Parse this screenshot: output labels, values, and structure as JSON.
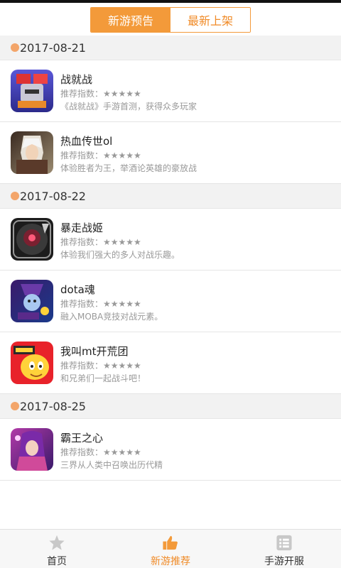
{
  "tabs": [
    {
      "label": "新游预告",
      "active": true
    },
    {
      "label": "最新上架",
      "active": false
    }
  ],
  "rating_label": "推荐指数：★★★★★",
  "sections": [
    {
      "date": "2017-08-21",
      "games": [
        {
          "name": "战就战",
          "rating": "推荐指数：★★★★★",
          "desc": "《战就战》手游首测，获得众多玩家",
          "icon": "knight-game-icon"
        },
        {
          "name": "热血传世ol",
          "rating": "推荐指数：★★★★★",
          "desc": "体验胜者为王，举酒论英雄的豪放战",
          "icon": "warrior-game-icon"
        }
      ]
    },
    {
      "date": "2017-08-22",
      "games": [
        {
          "name": "暴走战姬",
          "rating": "推荐指数：★★★★★",
          "desc": "体验我们强大的多人对战乐趣。",
          "icon": "dark-mech-game-icon"
        },
        {
          "name": "dota魂",
          "rating": "推荐指数：★★★★★",
          "desc": "融入MOBA竞技对战元素。",
          "icon": "mage-game-icon"
        },
        {
          "name": "我叫mt开荒团",
          "rating": "推荐指数：★★★★★",
          "desc": "和兄弟们一起战斗吧！",
          "icon": "cartoon-game-icon"
        }
      ]
    },
    {
      "date": "2017-08-25",
      "games": [
        {
          "name": "霸王之心",
          "rating": "推荐指数：★★★★★",
          "desc": "三界从人类中召唤出历代精",
          "icon": "heroine-game-icon"
        }
      ]
    }
  ],
  "bottom_nav": [
    {
      "label": "首页",
      "icon": "star-icon",
      "active": false
    },
    {
      "label": "新游推荐",
      "icon": "thumbs-up-icon",
      "active": true
    },
    {
      "label": "手游开服",
      "icon": "list-icon",
      "active": false
    }
  ],
  "colors": {
    "accent": "#f39a3a",
    "accent_text": "#f08b28",
    "section_bg": "#f2f2f2",
    "dot": "#f3a56a",
    "muted_text": "#999999"
  }
}
